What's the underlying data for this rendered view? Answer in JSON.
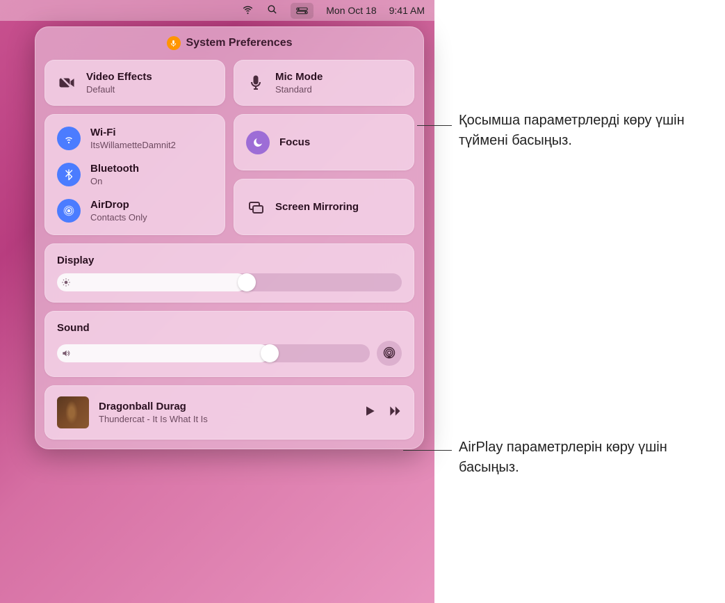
{
  "menubar": {
    "date": "Mon Oct 18",
    "time": "9:41 AM"
  },
  "controlCenter": {
    "headerTitle": "System Preferences",
    "videoEffects": {
      "title": "Video Effects",
      "sub": "Default"
    },
    "micMode": {
      "title": "Mic Mode",
      "sub": "Standard"
    },
    "wifi": {
      "title": "Wi-Fi",
      "sub": "ItsWillametteDamnit2"
    },
    "bluetooth": {
      "title": "Bluetooth",
      "sub": "On"
    },
    "airdrop": {
      "title": "AirDrop",
      "sub": "Contacts Only"
    },
    "focus": {
      "title": "Focus"
    },
    "screenMirroring": {
      "title": "Screen Mirroring"
    },
    "display": {
      "label": "Display",
      "value_percent": 55
    },
    "sound": {
      "label": "Sound",
      "value_percent": 68
    },
    "nowPlaying": {
      "title": "Dragonball Durag",
      "sub": "Thundercat - It Is What It Is"
    }
  },
  "callouts": {
    "micMode": "Қосымша параметрлерді көру үшін түймені басыңыз.",
    "airplay": "AirPlay параметрлерін көру үшін басыңыз."
  },
  "colors": {
    "accent_blue": "#4b7cff",
    "accent_purple": "#9d6dd6",
    "mic_orange": "#ff9500"
  }
}
